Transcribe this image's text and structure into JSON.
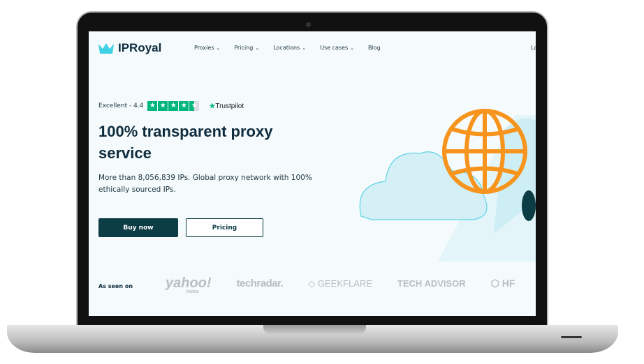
{
  "brand": {
    "name": "IPRoyal",
    "accent": "#0c3d45",
    "logo_color": "#3fd0e6"
  },
  "nav": {
    "items": [
      {
        "label": "Proxies",
        "has_dropdown": true
      },
      {
        "label": "Pricing",
        "has_dropdown": true
      },
      {
        "label": "Locations",
        "has_dropdown": true
      },
      {
        "label": "Use cases",
        "has_dropdown": true
      },
      {
        "label": "Blog",
        "has_dropdown": false
      }
    ],
    "login_partial": "Lo"
  },
  "rating": {
    "text": "Excellent - 4.4",
    "stars": 4.4,
    "provider": "Trustpilot"
  },
  "hero": {
    "title": "100% transparent proxy service",
    "subtitle": "More than 8,056,839 IPs. Global proxy network with 100% ethically sourced IPs.",
    "buy_label": "Buy now",
    "pricing_label": "Pricing"
  },
  "press": {
    "label": "As seen on",
    "logos": [
      "yahoo!",
      "news",
      "techradar.",
      "GEEKFLARE",
      "TECH ADVISOR",
      "HF"
    ]
  }
}
